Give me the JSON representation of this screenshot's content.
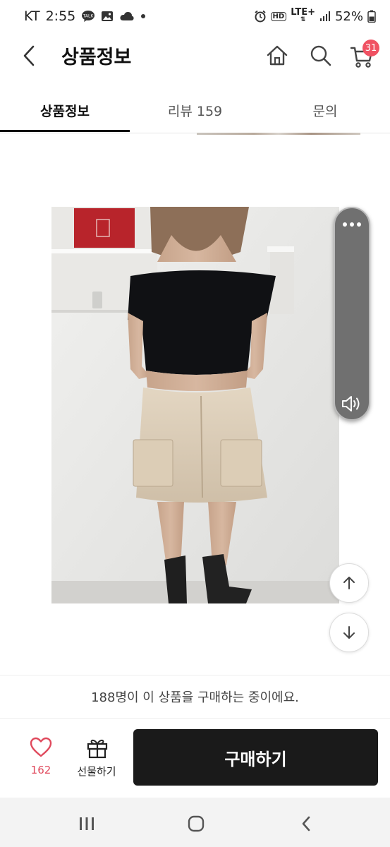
{
  "status_bar": {
    "carrier": "KT",
    "time": "2:55",
    "talk_badge": "TALK",
    "network": "LTE+",
    "hd": "HD",
    "battery": "52%"
  },
  "header": {
    "title": "상품정보",
    "cart_count": "31"
  },
  "tabs": [
    {
      "label": "상품정보",
      "active": true
    },
    {
      "label": "리뷰 159",
      "active": false
    },
    {
      "label": "문의",
      "active": false
    }
  ],
  "banner": {
    "text": "188명이 이 상품을 구매하는 중이에요."
  },
  "bottom_bar": {
    "likes": "162",
    "gift_label": "선물하기",
    "buy_label": "구매하기"
  },
  "colors": {
    "accent_red": "#f05263",
    "buy_button": "#1a1a1a"
  }
}
